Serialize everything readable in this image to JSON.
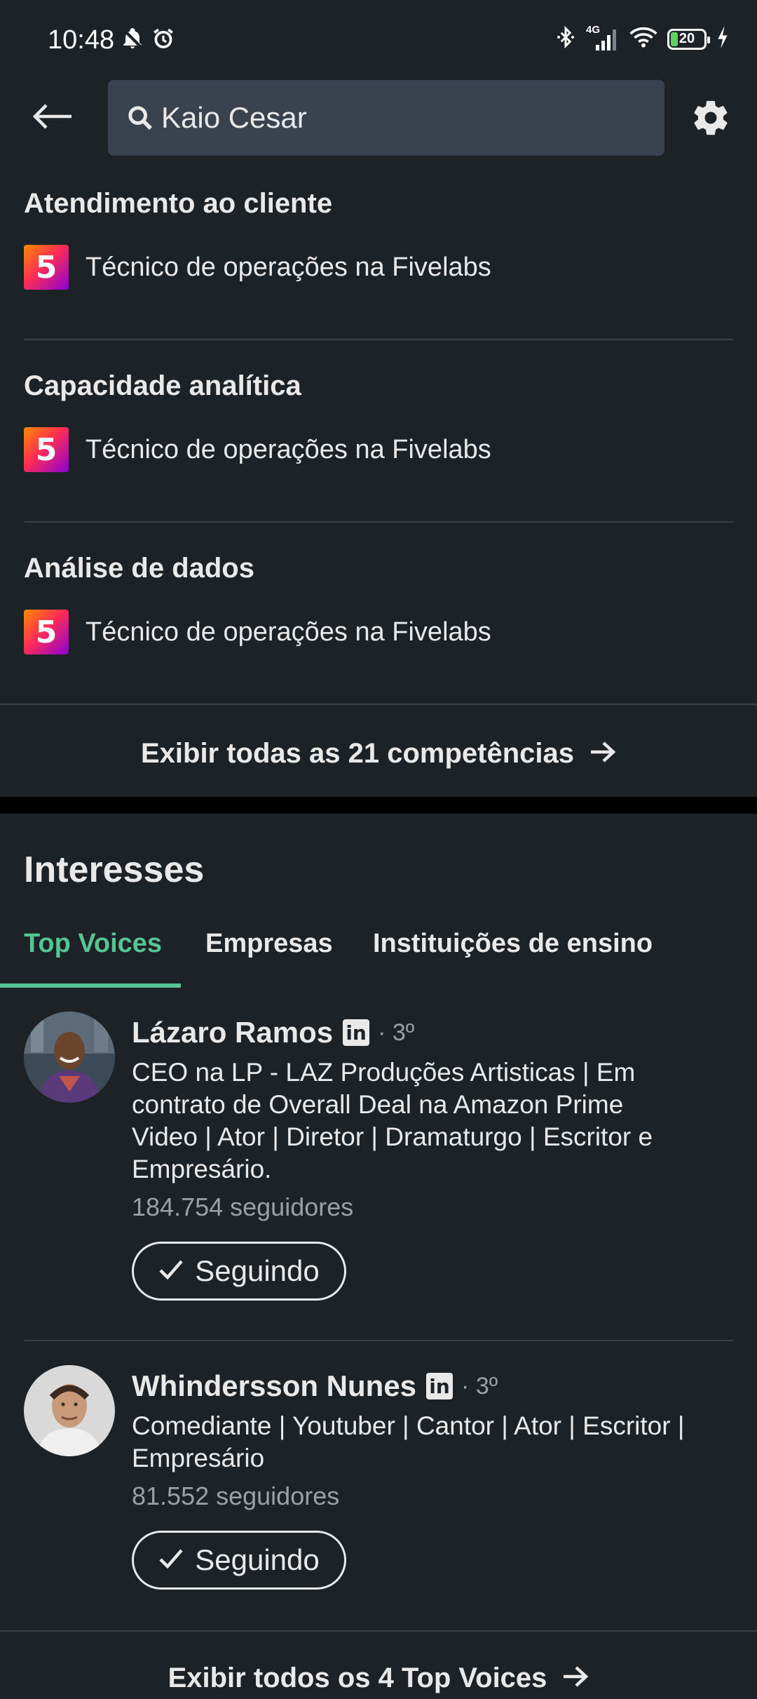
{
  "status_bar": {
    "time": "10:48",
    "network": "4G",
    "battery_level": "20",
    "battery_fraction": 0.2
  },
  "header": {
    "search_value": "Kaio Cesar"
  },
  "skills": [
    {
      "title": "Atendimento ao cliente",
      "detail": "Técnico de operações na Fivelabs",
      "logo_text": "5"
    },
    {
      "title": "Capacidade analítica",
      "detail": "Técnico de operações na Fivelabs",
      "logo_text": "5"
    },
    {
      "title": "Análise de dados",
      "detail": "Técnico de operações na Fivelabs",
      "logo_text": "5"
    }
  ],
  "skills_show_all": "Exibir todas as 21 competências",
  "interests": {
    "title": "Interesses",
    "tabs": [
      "Top Voices",
      "Empresas",
      "Instituições de ensino"
    ],
    "active_tab": "Top Voices",
    "people": [
      {
        "name": "Lázaro Ramos",
        "badge": "in",
        "degree": "· 3º",
        "headline_lines": [
          "CEO na LP - LAZ Produções Artisticas | Em",
          "contrato de Overall Deal na Amazon Prime",
          "Video | Ator | Diretor | Dramaturgo | Escritor e",
          "Empresário."
        ],
        "followers": "184.754 seguidores",
        "button": "Seguindo"
      },
      {
        "name": "Whindersson Nunes",
        "badge": "in",
        "degree": "· 3º",
        "headline_lines": [
          "Comediante | Youtuber | Cantor | Ator | Escritor |",
          "Empresário"
        ],
        "followers": "81.552 seguidores",
        "button": "Seguindo"
      }
    ],
    "show_all": "Exibir todos os 4 Top Voices"
  },
  "colors": {
    "background": "#1d2226",
    "accent_green": "#56c596",
    "search_bg": "#38434f"
  },
  "icons": {
    "back": "arrow-left-icon",
    "search": "search-icon",
    "settings": "gear-icon",
    "arrow": "arrow-right-icon",
    "check": "check-icon"
  }
}
